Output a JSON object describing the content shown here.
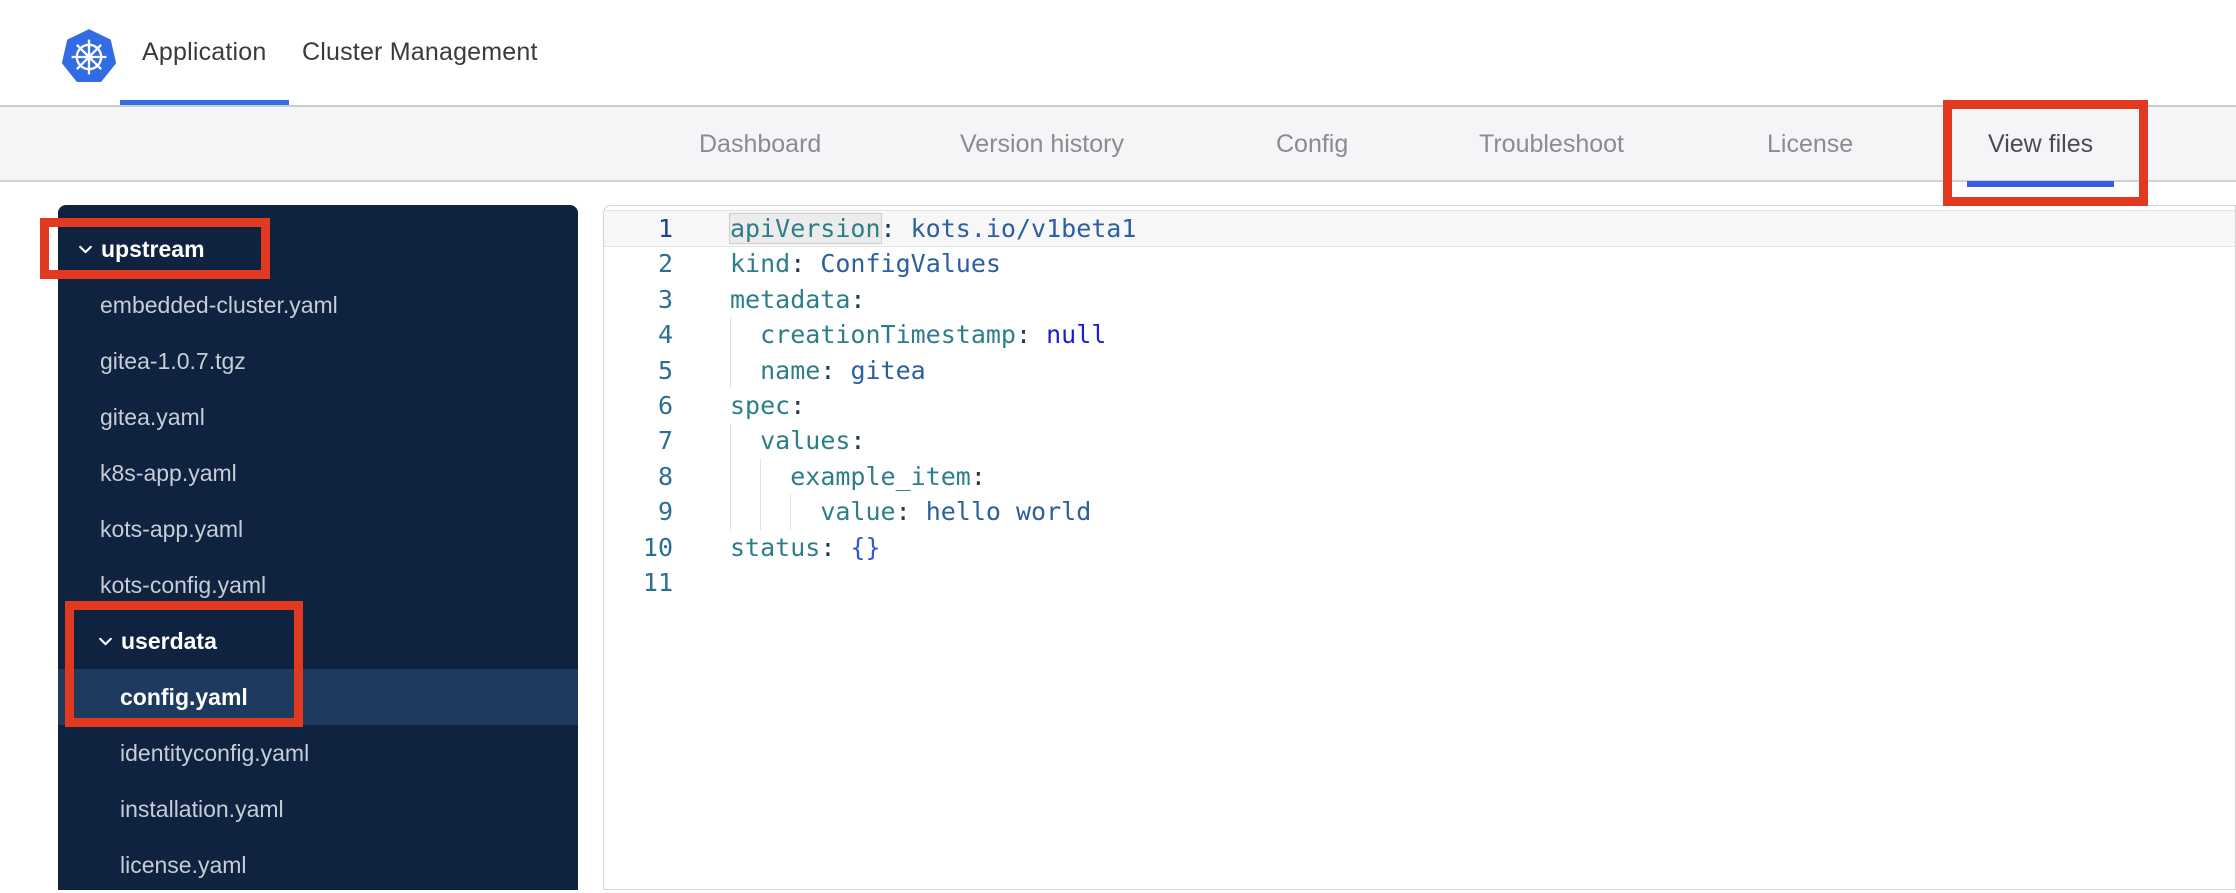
{
  "header": {
    "tabs": [
      {
        "label": "Application",
        "active": true
      },
      {
        "label": "Cluster Management",
        "active": false
      }
    ],
    "logo": "kubernetes-logo"
  },
  "nav": {
    "tabs": [
      {
        "label": "Dashboard",
        "active": false
      },
      {
        "label": "Version history",
        "active": false
      },
      {
        "label": "Config",
        "active": false
      },
      {
        "label": "Troubleshoot",
        "active": false
      },
      {
        "label": "License",
        "active": false
      },
      {
        "label": "View files",
        "active": true
      }
    ]
  },
  "sidebar": {
    "items": [
      {
        "label": "upstream",
        "type": "folder",
        "depth": 0,
        "expanded": true,
        "selected": false
      },
      {
        "label": "embedded-cluster.yaml",
        "type": "file",
        "depth": 0,
        "selected": false
      },
      {
        "label": "gitea-1.0.7.tgz",
        "type": "file",
        "depth": 0,
        "selected": false
      },
      {
        "label": "gitea.yaml",
        "type": "file",
        "depth": 0,
        "selected": false
      },
      {
        "label": "k8s-app.yaml",
        "type": "file",
        "depth": 0,
        "selected": false
      },
      {
        "label": "kots-app.yaml",
        "type": "file",
        "depth": 0,
        "selected": false
      },
      {
        "label": "kots-config.yaml",
        "type": "file",
        "depth": 0,
        "selected": false
      },
      {
        "label": "userdata",
        "type": "folder",
        "depth": 1,
        "expanded": true,
        "selected": false
      },
      {
        "label": "config.yaml",
        "type": "file",
        "depth": 1,
        "selected": true
      },
      {
        "label": "identityconfig.yaml",
        "type": "file",
        "depth": 1,
        "selected": false
      },
      {
        "label": "installation.yaml",
        "type": "file",
        "depth": 1,
        "selected": false
      },
      {
        "label": "license.yaml",
        "type": "file",
        "depth": 1,
        "selected": false
      }
    ]
  },
  "editor": {
    "language": "yaml",
    "lines": [
      {
        "num": 1,
        "active": true,
        "guides": 0,
        "tokens": [
          [
            "keyhl",
            "apiVersion"
          ],
          [
            "colon",
            ":"
          ],
          [
            "str",
            " kots.io/v1beta1"
          ]
        ]
      },
      {
        "num": 2,
        "guides": 0,
        "tokens": [
          [
            "key",
            "kind"
          ],
          [
            "colon",
            ":"
          ],
          [
            "str",
            " ConfigValues"
          ]
        ]
      },
      {
        "num": 3,
        "guides": 0,
        "tokens": [
          [
            "key",
            "metadata"
          ],
          [
            "colon",
            ":"
          ]
        ]
      },
      {
        "num": 4,
        "guides": 1,
        "tokens": [
          [
            "sp",
            "  "
          ],
          [
            "key",
            "creationTimestamp"
          ],
          [
            "colon",
            ":"
          ],
          [
            "null",
            " null"
          ]
        ]
      },
      {
        "num": 5,
        "guides": 1,
        "tokens": [
          [
            "sp",
            "  "
          ],
          [
            "key",
            "name"
          ],
          [
            "colon",
            ":"
          ],
          [
            "str",
            " gitea"
          ]
        ]
      },
      {
        "num": 6,
        "guides": 0,
        "tokens": [
          [
            "key",
            "spec"
          ],
          [
            "colon",
            ":"
          ]
        ]
      },
      {
        "num": 7,
        "guides": 1,
        "tokens": [
          [
            "sp",
            "  "
          ],
          [
            "key",
            "values"
          ],
          [
            "colon",
            ":"
          ]
        ]
      },
      {
        "num": 8,
        "guides": 2,
        "tokens": [
          [
            "sp",
            "    "
          ],
          [
            "key",
            "example_item"
          ],
          [
            "colon",
            ":"
          ]
        ]
      },
      {
        "num": 9,
        "guides": 3,
        "tokens": [
          [
            "sp",
            "      "
          ],
          [
            "key",
            "value"
          ],
          [
            "colon",
            ":"
          ],
          [
            "str",
            " hello world"
          ]
        ]
      },
      {
        "num": 10,
        "guides": 0,
        "tokens": [
          [
            "key",
            "status"
          ],
          [
            "colon",
            ":"
          ],
          [
            "brace",
            " {}"
          ]
        ]
      },
      {
        "num": 11,
        "guides": 0,
        "tokens": []
      }
    ]
  },
  "annotations": {
    "description": "red highlight boxes",
    "targets": [
      "view-files-tab",
      "upstream-folder",
      "userdata-and-config-yaml"
    ]
  },
  "colors": {
    "kubernetes_blue": "#326ce5",
    "header_underline": "#326de5",
    "nav_underline": "#3b5ede",
    "annotation_red": "#e13a20",
    "sidebar_bg": "#0f2240",
    "sidebar_selected": "#1e3a5e",
    "sidebar_file_text": "#c7cdd6",
    "code_key": "#2e7e8a",
    "code_colon": "#1c3c52",
    "code_value": "#2c5f9f",
    "code_null": "#1c1cdb",
    "code_brace": "#3457df",
    "line_number": "#2d6e93",
    "line_number_active": "#1f3f8f"
  }
}
